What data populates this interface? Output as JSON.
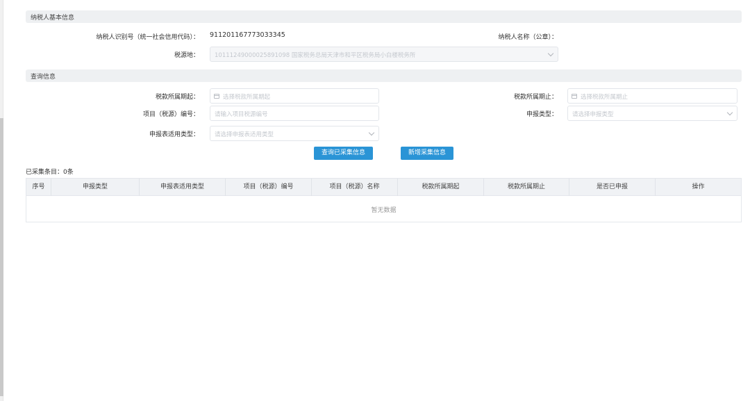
{
  "sections": {
    "taxpayer_info": "纳税人基本信息",
    "query_info": "查询信息"
  },
  "taxpayer": {
    "id_label": "纳税人识别号（统一社会信用代码）：",
    "id_value": "911201167773033345",
    "name_label": "纳税人名称（公章）：",
    "name_value": "",
    "source_label": "税源地：",
    "source_value": "10111249000025891098 国家税务总局天津市和平区税务局小白楼税务所"
  },
  "query": {
    "period_start_label": "税款所属期起：",
    "period_start_placeholder": "选择税款所属期起",
    "period_end_label": "税款所属期止：",
    "period_end_placeholder": "选择税款所属期止",
    "project_no_label": "项目（税源）编号：",
    "project_no_placeholder": "请输入项目税源编号",
    "declare_type_label": "申报类型：",
    "declare_type_placeholder": "请选择申报类型",
    "form_type_label": "申报表适用类型：",
    "form_type_placeholder": "请选择申报表适用类型"
  },
  "buttons": {
    "query": "查询已采集信息",
    "add": "新增采集信息"
  },
  "count_text": "已采集条目：0条",
  "table": {
    "headers": [
      "序号",
      "申报类型",
      "申报表适用类型",
      "项目（税源）编号",
      "项目（税源）名称",
      "税款所属期起",
      "税款所属期止",
      "是否已申报",
      "操作"
    ],
    "empty_text": "暂无数据"
  }
}
